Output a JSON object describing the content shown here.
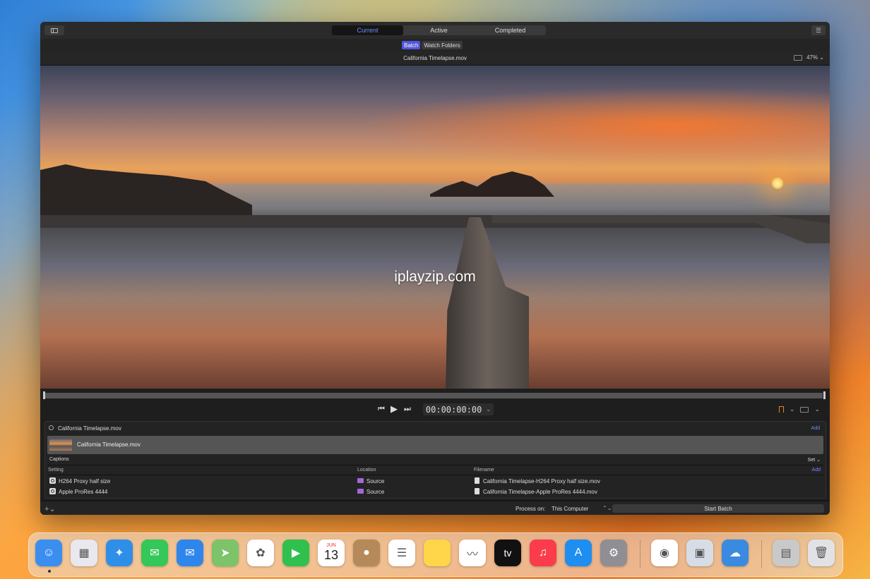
{
  "window": {
    "tabs": [
      {
        "label": "Current",
        "active": true
      },
      {
        "label": "Active",
        "active": false
      },
      {
        "label": "Completed",
        "active": false
      }
    ],
    "modes": [
      {
        "label": "Batch",
        "active": true
      },
      {
        "label": "Watch Folders",
        "active": false
      }
    ],
    "file_title": "California Timelapse.mov",
    "zoom": "47% ⌄",
    "watermark": "iplayzip.com",
    "colors": {
      "accent": "#4f56d6",
      "link": "#6f8cff",
      "bookmark": "#e0842a",
      "folder": "#a467d6"
    }
  },
  "transport": {
    "back_icon": "⏮",
    "play_icon": "▶",
    "forward_icon": "⏭",
    "timecode": "00:00:00:00",
    "timecode_caret": "⌄",
    "bookmark_caret": "⌄",
    "monitor_caret": "⌄"
  },
  "batch": {
    "source_title": "California Timelapse.mov",
    "add_label": "Add",
    "job_name": "California Timelapse.mov",
    "captions_label": "Captions",
    "set_label": "Set ⌄",
    "columns": {
      "setting": "Setting",
      "location": "Location",
      "filename": "Filename",
      "add": "Add"
    },
    "outputs": [
      {
        "setting": "H264 Proxy half size",
        "location": "Source",
        "filename": "California Timelapse-H264 Proxy half size.mov"
      },
      {
        "setting": "Apple ProRes 4444",
        "location": "Source",
        "filename": "California Timelapse-Apple ProRes 4444.mov"
      }
    ]
  },
  "footer": {
    "plus_label": "+⌄",
    "process_on_label": "Process on:",
    "process_on_value": "This Computer",
    "process_caret": "⌃⌄",
    "start_batch": "Start Batch"
  },
  "dock": {
    "items": [
      {
        "name": "finder-icon",
        "color": "#3a8ef0"
      },
      {
        "name": "launchpad-icon",
        "color": "#e8e8ee"
      },
      {
        "name": "safari-icon",
        "color": "#2f8fe8"
      },
      {
        "name": "messages-icon",
        "color": "#34c759"
      },
      {
        "name": "mail-icon",
        "color": "#2e86ec"
      },
      {
        "name": "maps-icon",
        "color": "#7cc36a"
      },
      {
        "name": "photos-icon",
        "color": "#ffffff"
      },
      {
        "name": "facetime-icon",
        "color": "#30c04e"
      },
      {
        "name": "calendar-icon",
        "color": "#ffffff",
        "month": "JUN",
        "day": "13"
      },
      {
        "name": "contacts-icon",
        "color": "#b58a5a"
      },
      {
        "name": "reminders-icon",
        "color": "#ffffff"
      },
      {
        "name": "notes-icon",
        "color": "#ffd54a"
      },
      {
        "name": "freeform-icon",
        "color": "#ffffff"
      },
      {
        "name": "tv-icon",
        "color": "#111111",
        "label": "tv"
      },
      {
        "name": "music-icon",
        "color": "#fa3c4c"
      },
      {
        "name": "app-store-icon",
        "color": "#1e8ef0"
      },
      {
        "name": "system-settings-icon",
        "color": "#8e8e93"
      },
      {
        "name": "chrome-icon",
        "color": "#ffffff"
      },
      {
        "name": "preview-icon",
        "color": "#d7dde6"
      },
      {
        "name": "weather-icon",
        "color": "#3a8be0"
      },
      {
        "name": "compressor-icon",
        "color": "#c9c9c9"
      },
      {
        "name": "trash-icon",
        "color": "#e2e2e6"
      }
    ]
  }
}
